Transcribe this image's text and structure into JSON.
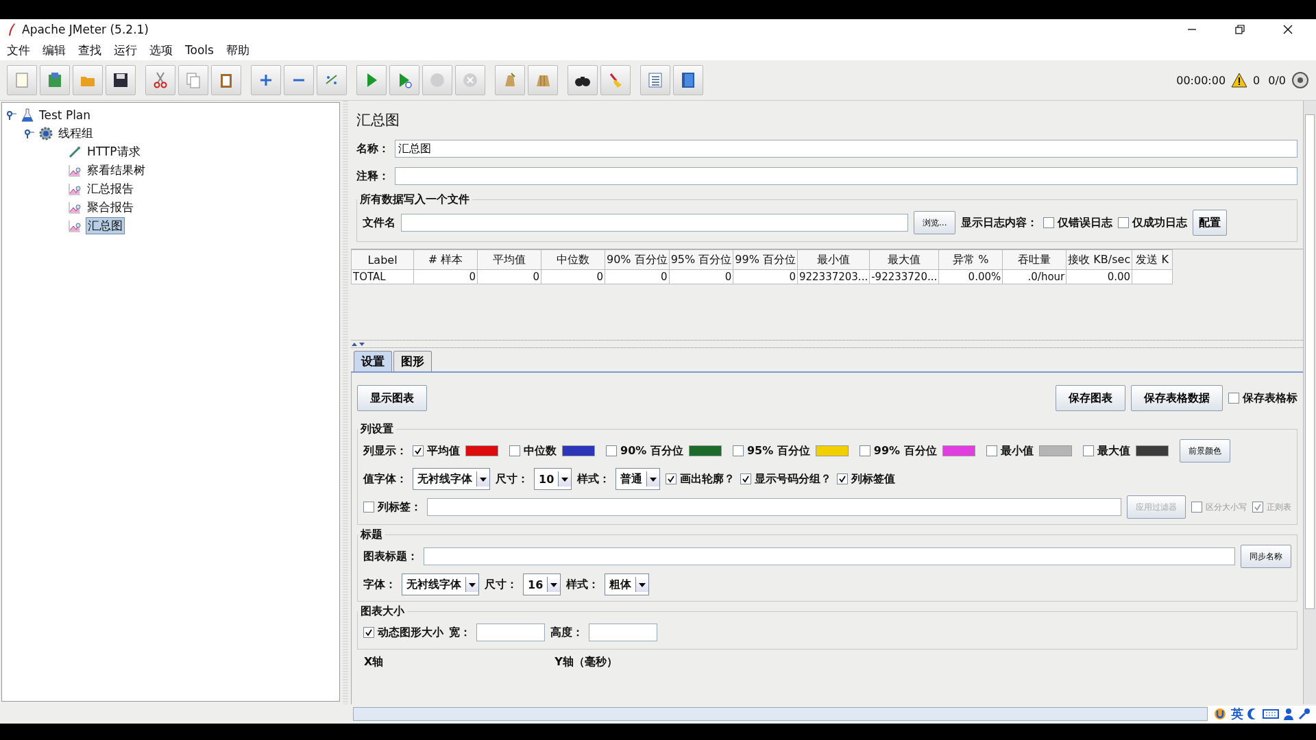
{
  "window": {
    "title": "Apache JMeter (5.2.1)"
  },
  "menu": [
    "文件",
    "编辑",
    "查找",
    "运行",
    "选项",
    "Tools",
    "帮助"
  ],
  "status": {
    "time": "00:00:00",
    "warnings": "0",
    "threads": "0/0"
  },
  "tree": [
    {
      "label": "Test Plan",
      "selected": false,
      "expanded": true,
      "children": [
        {
          "label": "线程组",
          "selected": false,
          "expanded": true,
          "children": [
            {
              "label": "HTTP请求",
              "selected": false,
              "kind": "sampler"
            },
            {
              "label": "察看结果树",
              "selected": false,
              "kind": "listener"
            },
            {
              "label": "汇总报告",
              "selected": false,
              "kind": "listener"
            },
            {
              "label": "聚合报告",
              "selected": false,
              "kind": "listener"
            },
            {
              "label": "汇总图",
              "selected": true,
              "kind": "listener"
            }
          ]
        }
      ]
    }
  ],
  "panel": {
    "title": "汇总图",
    "name_label": "名称：",
    "name_value": "汇总图",
    "comment_label": "注释：",
    "file_group": "所有数据写入一个文件",
    "file_label": "文件名",
    "browse": "浏览...",
    "log_label": "显示日志内容：",
    "log_options": [
      {
        "label": "仅错误日志",
        "checked": false
      },
      {
        "label": "仅成功日志",
        "checked": false
      }
    ],
    "config": "配置"
  },
  "table": {
    "columns": [
      "Label",
      "# 样本",
      "平均值",
      "中位数",
      "90% 百分位",
      "95% 百分位",
      "99% 百分位",
      "最小值",
      "最大值",
      "异常 %",
      "吞吐量",
      "接收 KB/sec",
      "发送 K"
    ],
    "rows": [
      [
        "TOTAL",
        "0",
        "0",
        "0",
        "0",
        "0",
        "0",
        "922337203...",
        "-92233720...",
        "0.00%",
        ".0/hour",
        "0.00"
      ]
    ]
  },
  "tabs": [
    {
      "label": "设置",
      "selected": true
    },
    {
      "label": "图形",
      "selected": false
    }
  ],
  "settings": {
    "show_chart": "显示图表",
    "save_chart": "保存图表",
    "save_table": "保存表格数据",
    "save_header": {
      "label": "保存表格标",
      "checked": false
    },
    "columns_group": "列设置",
    "columns_label": "列显示：",
    "series": [
      {
        "label": "平均值",
        "checked": true,
        "color": "#dd0d0d"
      },
      {
        "label": "中位数",
        "checked": false,
        "color": "#2c36b8"
      },
      {
        "label": "90% 百分位",
        "checked": false,
        "color": "#1c6b2a"
      },
      {
        "label": "95% 百分位",
        "checked": false,
        "color": "#f2d000"
      },
      {
        "label": "99% 百分位",
        "checked": false,
        "color": "#e03ee0"
      },
      {
        "label": "最小值",
        "checked": false,
        "color": "#b5b5b5"
      },
      {
        "label": "最大值",
        "checked": false,
        "color": "#3c3c3c"
      }
    ],
    "fg_color": "前景颜色",
    "value_font_label": "值字体：",
    "value_font": "无衬线字体",
    "size_label": "尺寸：",
    "value_size": "10",
    "style_label": "样式：",
    "value_style": "普通",
    "value_options": [
      {
        "label": "画出轮廓？",
        "checked": true
      },
      {
        "label": "显示号码分组？",
        "checked": true
      },
      {
        "label": "列标签值",
        "checked": true
      }
    ],
    "label_filter": {
      "label": "列标签：",
      "checked": false
    },
    "apply_filter": "应用过滤器",
    "filter_options": [
      {
        "label": "区分大小写",
        "checked": false
      },
      {
        "label": "正则表",
        "checked": true
      }
    ],
    "title_group": "标题",
    "chart_title_label": "图表标题：",
    "sync_name": "同步名称",
    "font_label": "字体：",
    "title_font": "无衬线字体",
    "title_size_label": "尺寸：",
    "title_size": "16",
    "title_style_label": "样式：",
    "title_style": "粗体",
    "size_group": "图表大小",
    "dynamic_size": {
      "label": "动态图形大小",
      "checked": true
    },
    "width_label": "宽：",
    "height_label": "高度：",
    "x_axis_group": "X轴",
    "y_axis_group": "Y轴（毫秒）"
  },
  "ime": "英"
}
